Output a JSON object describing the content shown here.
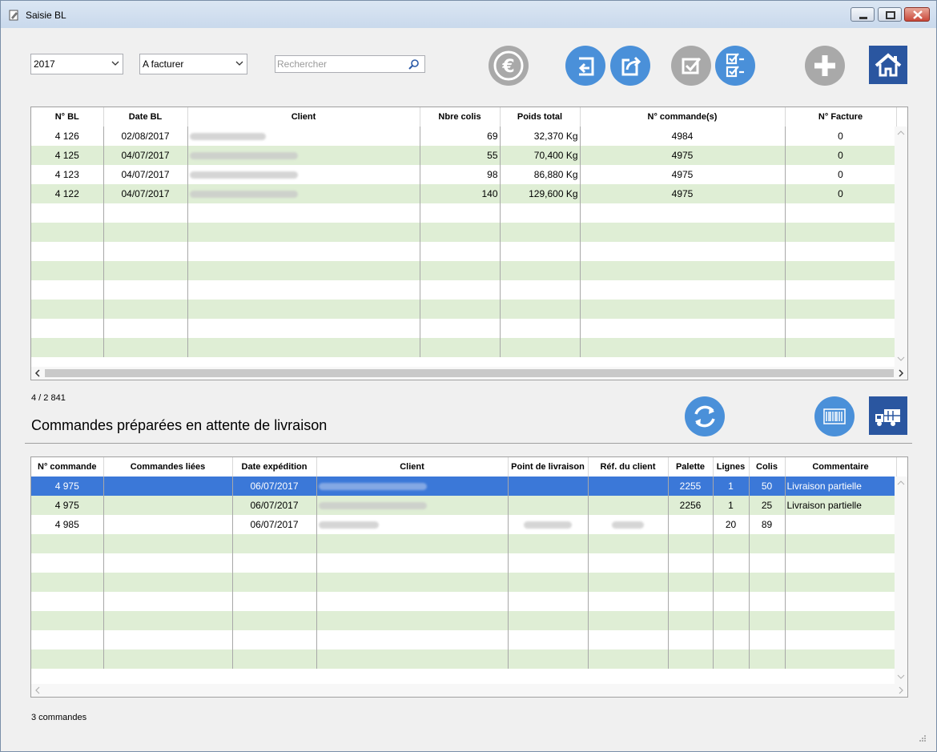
{
  "window": {
    "title": "Saisie BL"
  },
  "filters": {
    "year": "2017",
    "status": "A facturer",
    "search_placeholder": "Rechercher"
  },
  "toolbar": {
    "icons": [
      "euro-icon",
      "import-icon",
      "export-icon",
      "validate-icon",
      "validate-all-icon",
      "add-icon",
      "home-icon"
    ]
  },
  "bl_table": {
    "columns": [
      "N° BL",
      "Date BL",
      "Client",
      "Nbre colis",
      "Poids total",
      "N° commande(s)",
      "N° Facture"
    ],
    "rows": [
      {
        "num": "4 126",
        "date": "02/08/2017",
        "colis": "69",
        "poids": "32,370 Kg",
        "commande": "4984",
        "facture": "0"
      },
      {
        "num": "4 125",
        "date": "04/07/2017",
        "colis": "55",
        "poids": "70,400 Kg",
        "commande": "4975",
        "facture": "0"
      },
      {
        "num": "4 123",
        "date": "04/07/2017",
        "colis": "98",
        "poids": "86,880 Kg",
        "commande": "4975",
        "facture": "0"
      },
      {
        "num": "4 122",
        "date": "04/07/2017",
        "colis": "140",
        "poids": "129,600 Kg",
        "commande": "4975",
        "facture": "0"
      }
    ],
    "count_label": "4 / 2 841"
  },
  "orders_section": {
    "title": "Commandes préparées en attente de livraison",
    "columns": [
      "N° commande",
      "Commandes liées",
      "Date expédition",
      "Client",
      "Point de livraison",
      "Réf. du client",
      "Palette",
      "Lignes",
      "Colis",
      "Commentaire"
    ],
    "rows": [
      {
        "num": "4 975",
        "liees": "",
        "date": "06/07/2017",
        "palette": "2255",
        "lignes": "1",
        "colis": "50",
        "commentaire": "Livraison partielle"
      },
      {
        "num": "4 975",
        "liees": "",
        "date": "06/07/2017",
        "palette": "2256",
        "lignes": "1",
        "colis": "25",
        "commentaire": "Livraison partielle"
      },
      {
        "num": "4 985",
        "liees": "",
        "date": "06/07/2017",
        "palette": "",
        "lignes": "20",
        "colis": "89",
        "commentaire": ""
      }
    ],
    "count_label": "3 commandes"
  },
  "colors": {
    "accent": "#4a90d9",
    "selection": "#3b78d8",
    "alt_row": "#dfeed5",
    "disabled_icon": "#a9a9a9",
    "home": "#2a56a0"
  }
}
